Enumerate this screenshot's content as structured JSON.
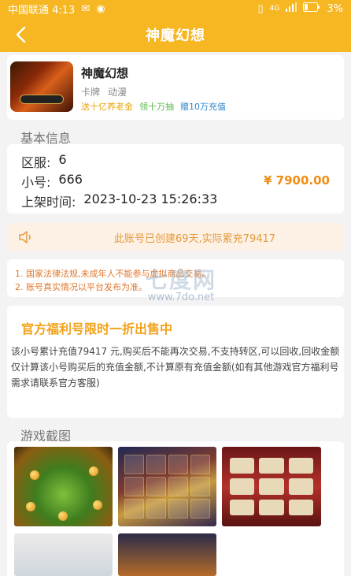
{
  "status_bar": {
    "carrier_time": "中国联通 4:13",
    "network": "4G",
    "battery": "3%"
  },
  "nav": {
    "title": "神魔幻想"
  },
  "game": {
    "name": "神魔幻想",
    "tags": [
      "卡牌",
      "动漫"
    ],
    "promos": [
      "送十亿养老金",
      "领十万抽",
      "赠10万充值"
    ]
  },
  "basic_info": {
    "title": "基本信息",
    "server_label": "区服:",
    "server_value": "6",
    "account_label": "小号:",
    "account_value": "666",
    "listed_label": "上架时间:",
    "listed_value": "2023-10-23 15:26:33",
    "price": "¥ 7900.00"
  },
  "notice": {
    "text": "此账号已创建69天,实际累充79417"
  },
  "rules": [
    "1. 国家法律法规,未成年人不能参与虚拟商品交易。",
    "2. 账号真实情况以平台发布为准。"
  ],
  "watermark": {
    "big": "七度网",
    "small": "www.7do.net"
  },
  "promo_section": {
    "title": "官方福利号限时一折出售中",
    "description": "该小号累计充值79417 元,购买后不能再次交易,不支持转区,可以回收,回收金额仅计算该小号购买后的充值金额,不计算原有充值金额(如有其他游戏官方福利号需求请联系官方客服)"
  },
  "screenshots": {
    "title": "游戏截图",
    "count": 5
  },
  "colors": {
    "brand": "#f6b722",
    "price": "#f08d14",
    "notice_text": "#e59a3a",
    "rule_text": "#e0782f"
  }
}
